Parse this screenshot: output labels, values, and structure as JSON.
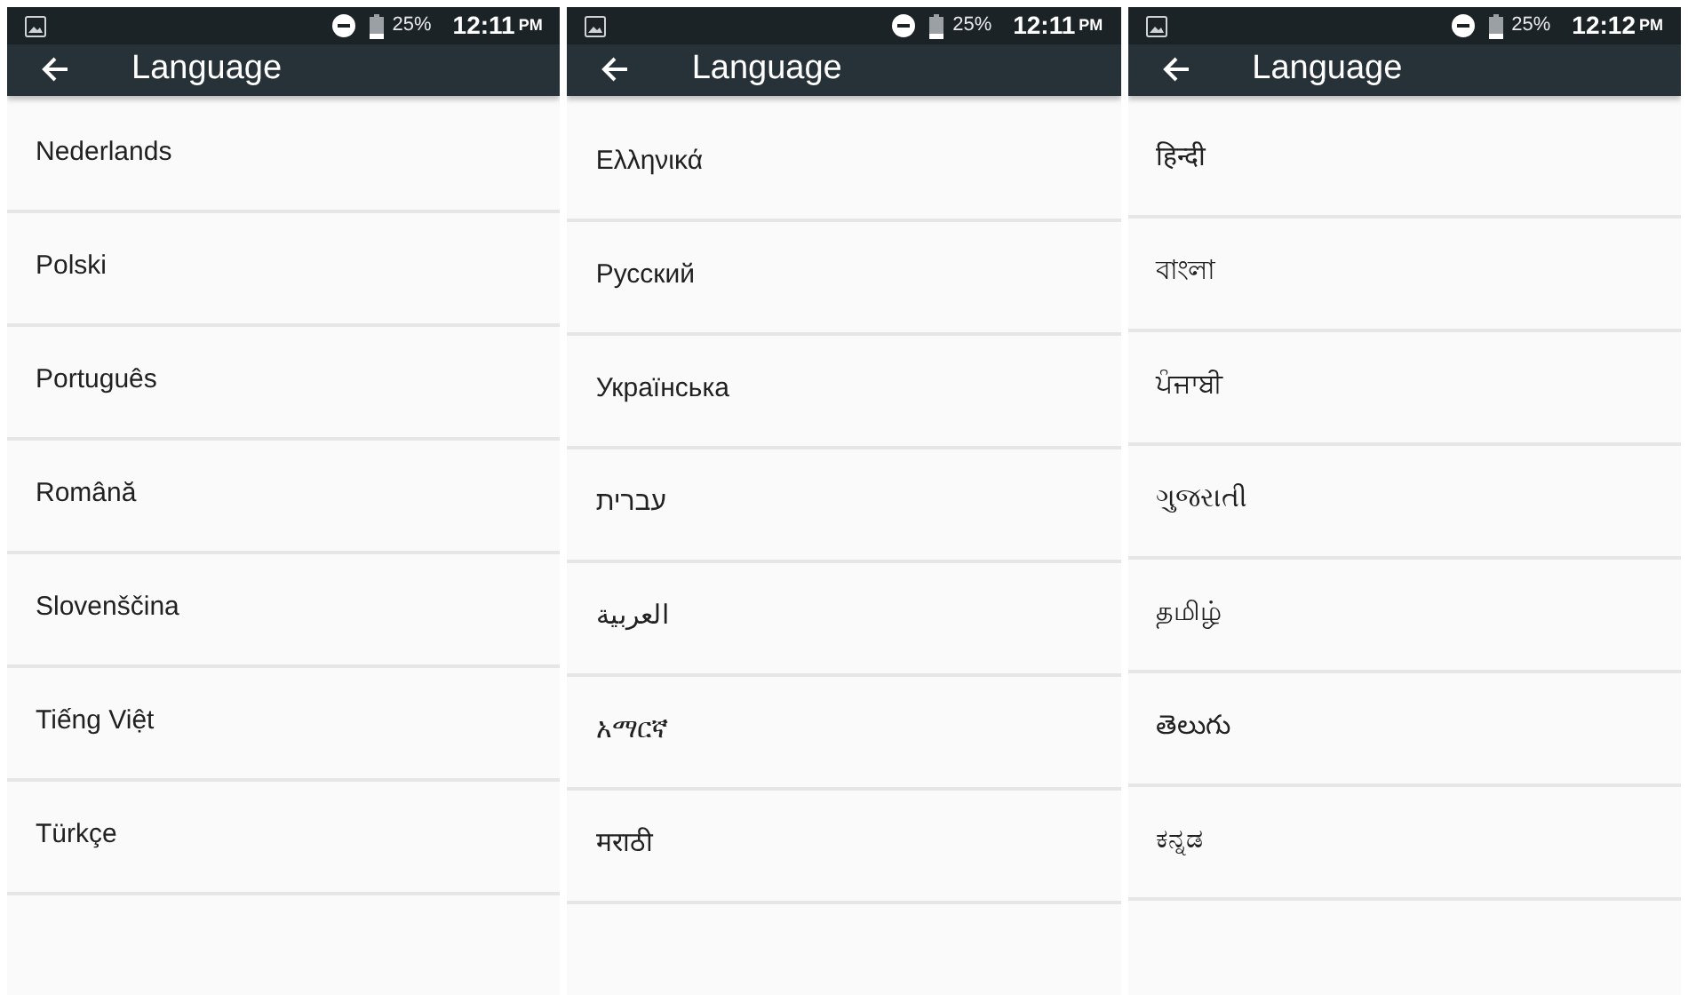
{
  "screens": [
    {
      "status_bar": {
        "battery": "25%",
        "time": "12:11",
        "meridiem": "PM"
      },
      "title": "Language",
      "items": [
        "Nederlands",
        "Polski",
        "Português",
        "Română",
        "Slovenščina",
        "Tiếng Việt",
        "Türkçe"
      ]
    },
    {
      "status_bar": {
        "battery": "25%",
        "time": "12:11",
        "meridiem": "PM"
      },
      "title": "Language",
      "items": [
        "Ελληνικά",
        "Русский",
        "Українська",
        "עברית",
        "العربية",
        "አማርኛ",
        "मराठी"
      ]
    },
    {
      "status_bar": {
        "battery": "25%",
        "time": "12:12",
        "meridiem": "PM"
      },
      "title": "Language",
      "items": [
        "हिन्दी",
        "বাংলা",
        "ਪੰਜਾਬੀ",
        "ગુજરાતી",
        "தமிழ்",
        "తెలుగు",
        "ಕನ್ನಡ"
      ]
    }
  ]
}
